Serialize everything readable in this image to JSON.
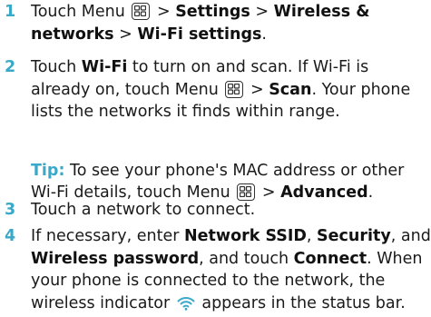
{
  "steps": {
    "s1": {
      "num": "1",
      "t1": "Touch Menu ",
      "t2": " > ",
      "b1": "Settings",
      "t3": " > ",
      "b2": "Wireless & networks",
      "t4": " > ",
      "b3": "Wi-Fi settings",
      "t5": "."
    },
    "s2": {
      "num": "2",
      "t1": "Touch ",
      "b1": "Wi-Fi",
      "t2": " to turn on and scan. If Wi-Fi is already on, touch Menu ",
      "t3": " > ",
      "b2": "Scan",
      "t4": ". Your phone lists the networks it finds within range."
    },
    "tip": {
      "label": "Tip:",
      "t1": " To see your phone's MAC address or other Wi-Fi details, touch Menu ",
      "t2": " > ",
      "b1": "Advanced",
      "t3": "."
    },
    "s3": {
      "num": "3",
      "t1": "Touch a network to connect."
    },
    "s4": {
      "num": "4",
      "t1": "If necessary, enter ",
      "b1": "Network SSID",
      "t2": ", ",
      "b2": "Security",
      "t3": ", and ",
      "b3": "Wireless password",
      "t4": ", and touch ",
      "b4": "Connect",
      "t5": ". When your phone is connected to the network, the wireless indicator ",
      "t6": " appears in the status bar."
    }
  },
  "icons": {
    "menu": "menu-key-icon",
    "wifi": "wifi-indicator-icon"
  },
  "colors": {
    "accent": "#3aa8c9",
    "text": "#1a1a1a"
  }
}
